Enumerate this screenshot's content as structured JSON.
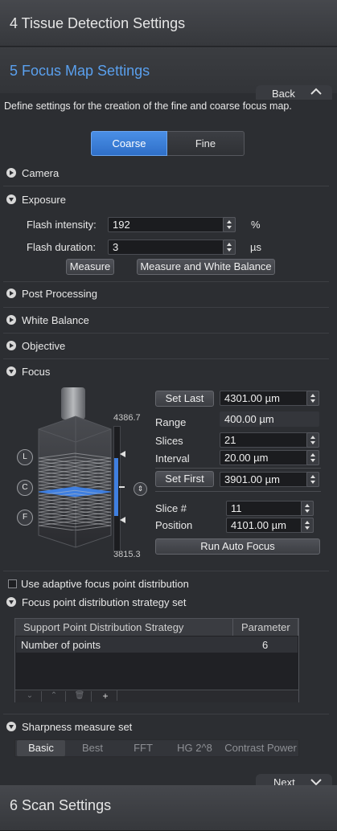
{
  "sections": {
    "tissue": "4 Tissue Detection Settings",
    "focus_map": "5 Focus Map Settings",
    "scan": "6 Scan Settings"
  },
  "nav": {
    "back": "Back",
    "next": "Next"
  },
  "description": "Define settings for the creation of the fine and coarse focus map.",
  "mode": {
    "coarse": "Coarse",
    "fine": "Fine",
    "selected": "Coarse"
  },
  "groups": {
    "camera": "Camera",
    "exposure": "Exposure",
    "post_processing": "Post Processing",
    "white_balance": "White Balance",
    "objective": "Objective",
    "focus": "Focus"
  },
  "exposure": {
    "flash_intensity_label": "Flash intensity:",
    "flash_intensity_value": "192",
    "flash_intensity_unit": "%",
    "flash_duration_label": "Flash duration:",
    "flash_duration_value": "3",
    "flash_duration_unit": "µs",
    "measure": "Measure",
    "measure_wb": "Measure and White Balance"
  },
  "focus": {
    "top_value": "4386.7",
    "bottom_value": "3815.3",
    "marker_l": "L",
    "marker_c": "C",
    "marker_f": "F",
    "set_last": "Set Last",
    "set_last_value": "4301.00 µm",
    "range_label": "Range",
    "range_value": "400.00 µm",
    "slices_label": "Slices",
    "slices_value": "21",
    "interval_label": "Interval",
    "interval_value": "20.00 µm",
    "set_first": "Set First",
    "set_first_value": "3901.00 µm",
    "slice_num_label": "Slice #",
    "slice_num_value": "11",
    "position_label": "Position",
    "position_value": "4101.00 µm",
    "run_auto_focus": "Run Auto Focus"
  },
  "adaptive": {
    "label": "Use adaptive focus point distribution",
    "checked": false
  },
  "strategy": {
    "section": "Focus point distribution strategy set",
    "col_strategy": "Support Point Distribution Strategy",
    "col_parameter": "Parameter",
    "rows": [
      {
        "name": "Number of points",
        "value": "6"
      }
    ]
  },
  "sharpness": {
    "section": "Sharpness measure set",
    "tabs": [
      "Basic",
      "Best",
      "FFT",
      "HG 2^8",
      "Contrast Power"
    ],
    "selected": "Basic"
  },
  "colors": {
    "accent": "#5aa0ee",
    "selected_button": "#3d7fd8",
    "focus_plane": "#3f7fe0"
  }
}
